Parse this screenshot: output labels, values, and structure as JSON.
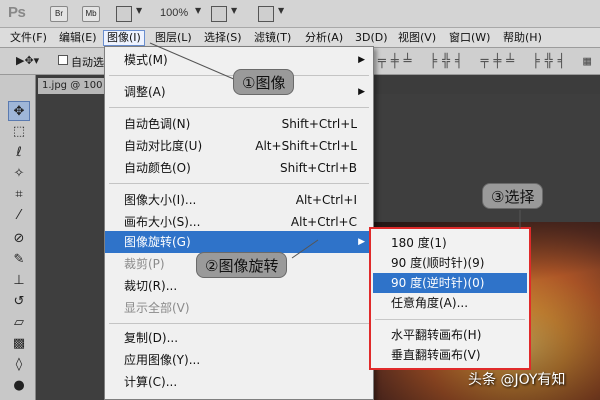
{
  "app": {
    "logo": "Ps",
    "br_button": "Br",
    "mb_button": "Mb",
    "zoom": "100%"
  },
  "menubar": {
    "items": [
      "文件(F)",
      "编辑(E)",
      "图像(I)",
      "图层(L)",
      "选择(S)",
      "滤镜(T)",
      "分析(A)",
      "3D(D)",
      "视图(V)",
      "窗口(W)",
      "帮助(H)"
    ]
  },
  "options": {
    "auto_select": "自动选"
  },
  "document": {
    "tab": "1.jpg @ 100"
  },
  "menu": {
    "items": [
      {
        "label": "模式(M)",
        "shortcut": "",
        "submenu": true,
        "disabled": false
      },
      {
        "label": "调整(A)",
        "shortcut": "",
        "submenu": true,
        "disabled": false
      },
      {
        "label": "自动色调(N)",
        "shortcut": "Shift+Ctrl+L",
        "submenu": false,
        "disabled": false
      },
      {
        "label": "自动对比度(U)",
        "shortcut": "Alt+Shift+Ctrl+L",
        "submenu": false,
        "disabled": false
      },
      {
        "label": "自动颜色(O)",
        "shortcut": "Shift+Ctrl+B",
        "submenu": false,
        "disabled": false
      },
      {
        "label": "图像大小(I)...",
        "shortcut": "Alt+Ctrl+I",
        "submenu": false,
        "disabled": false
      },
      {
        "label": "画布大小(S)...",
        "shortcut": "Alt+Ctrl+C",
        "submenu": false,
        "disabled": false
      },
      {
        "label": "图像旋转(G)",
        "shortcut": "",
        "submenu": true,
        "disabled": false,
        "highlighted": true
      },
      {
        "label": "裁剪(P)",
        "shortcut": "",
        "submenu": false,
        "disabled": true
      },
      {
        "label": "裁切(R)...",
        "shortcut": "",
        "submenu": false,
        "disabled": false
      },
      {
        "label": "显示全部(V)",
        "shortcut": "",
        "submenu": false,
        "disabled": true
      },
      {
        "label": "复制(D)...",
        "shortcut": "",
        "submenu": false,
        "disabled": false
      },
      {
        "label": "应用图像(Y)...",
        "shortcut": "",
        "submenu": false,
        "disabled": false
      },
      {
        "label": "计算(C)...",
        "shortcut": "",
        "submenu": false,
        "disabled": false
      }
    ]
  },
  "submenu": {
    "items": [
      {
        "label": "180 度(1)"
      },
      {
        "label": "90 度(顺时针)(9)"
      },
      {
        "label": "90 度(逆时针)(0)",
        "highlighted": true
      },
      {
        "label": "任意角度(A)..."
      },
      {
        "label": "水平翻转画布(H)"
      },
      {
        "label": "垂直翻转画布(V)"
      }
    ]
  },
  "callouts": {
    "step1": "①图像",
    "step2": "②图像旋转",
    "step3": "③选择"
  },
  "watermark": "头条 @JOY有知",
  "colors": {
    "highlight": "#2f73c9",
    "submenu_border": "#e02a2a",
    "callout_bg": "#9a9a9a"
  }
}
